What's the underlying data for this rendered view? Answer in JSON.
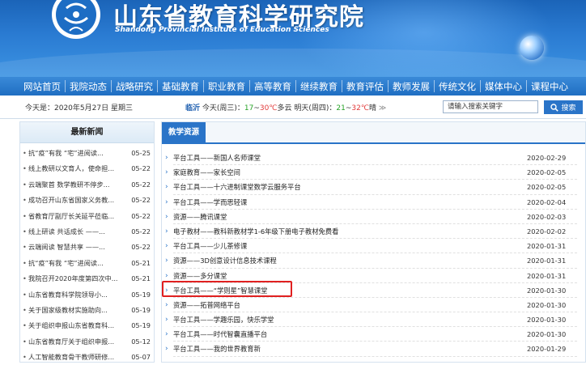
{
  "header": {
    "title": "山东省教育科学研究院",
    "subtitle": "Shandong Provincial Institute of Education Sciences"
  },
  "nav": {
    "items": [
      {
        "label": "网站首页"
      },
      {
        "label": "我院动态"
      },
      {
        "label": "战略研究"
      },
      {
        "label": "基础教育"
      },
      {
        "label": "职业教育"
      },
      {
        "label": "高等教育"
      },
      {
        "label": "继续教育"
      },
      {
        "label": "教育评估"
      },
      {
        "label": "教师发展"
      },
      {
        "label": "传统文化"
      },
      {
        "label": "媒体中心"
      },
      {
        "label": "课程中心"
      }
    ]
  },
  "infobar": {
    "date": "今天是：2020年5月27日 星期三",
    "city": "临沂",
    "today_label": "今天(周三)：",
    "today_low": "17",
    "today_mid": "~",
    "today_high": "30℃",
    "today_weather": "多云",
    "tomorrow_label": "明天(周四)：",
    "tomorrow_low": "21",
    "tomorrow_mid": "~",
    "tomorrow_high": "32℃",
    "tomorrow_weather": "晴",
    "more": "≫"
  },
  "search": {
    "placeholder": "请输入搜索关键字",
    "button_label": "搜索"
  },
  "left_panel": {
    "title": "最新新闻",
    "items": [
      {
        "title": "抗“疫”有我 “宅”进阅读...",
        "date": "05-25"
      },
      {
        "title": "线上教研以文育人，使命担...",
        "date": "05-22"
      },
      {
        "title": "云端聚首 数学教研不停步...",
        "date": "05-22"
      },
      {
        "title": "成功召开山东省国家义务教...",
        "date": "05-22"
      },
      {
        "title": "省教育厅副厅长关延平莅临...",
        "date": "05-22"
      },
      {
        "title": "线上研读 共话成长 ——...",
        "date": "05-22"
      },
      {
        "title": "云端阅读 智慧共享 ——...",
        "date": "05-22"
      },
      {
        "title": "抗“疫”有我 “宅”进阅读...",
        "date": "05-21"
      },
      {
        "title": "我院召开2020年度第四次中...",
        "date": "05-21"
      },
      {
        "title": "山东省教育科学院领导小...",
        "date": "05-19"
      },
      {
        "title": "关于国家级教材实施助向...",
        "date": "05-19"
      },
      {
        "title": "关于组织申报山东省教育科...",
        "date": "05-19"
      },
      {
        "title": "山东省教育厅关于组织申报...",
        "date": "05-12"
      },
      {
        "title": "人工智能教育骨干教师研修...",
        "date": "05-07"
      }
    ]
  },
  "right_panel": {
    "tab": "教学资源",
    "items": [
      {
        "title": "平台工具——新国人名师课堂",
        "date": "2020-02-29"
      },
      {
        "title": "家庭教育——家长空间",
        "date": "2020-02-05"
      },
      {
        "title": "平台工具——十六进制课堂数学云服务平台",
        "date": "2020-02-05"
      },
      {
        "title": "平台工具——学而思轻课",
        "date": "2020-02-04"
      },
      {
        "title": "资源——腾讯课堂",
        "date": "2020-02-03"
      },
      {
        "title": "电子教材——教科新教材学1-6年级下册电子教材免费看",
        "date": "2020-02-02"
      },
      {
        "title": "平台工具——少儿茶修课",
        "date": "2020-01-31"
      },
      {
        "title": "资源——3D创意设计信息技术课程",
        "date": "2020-01-31"
      },
      {
        "title": "资源——多分课堂",
        "date": "2020-01-31"
      },
      {
        "title": "平台工具——“学则星”智慧课堂",
        "date": "2020-01-30"
      },
      {
        "title": "资源——拓普网络平台",
        "date": "2020-01-30"
      },
      {
        "title": "平台工具——学趣乐园，快乐学堂",
        "date": "2020-01-30"
      },
      {
        "title": "平台工具——时代智囊直播平台",
        "date": "2020-01-30"
      },
      {
        "title": "平台工具——我的世界教育新",
        "date": "2020-01-29"
      }
    ]
  }
}
